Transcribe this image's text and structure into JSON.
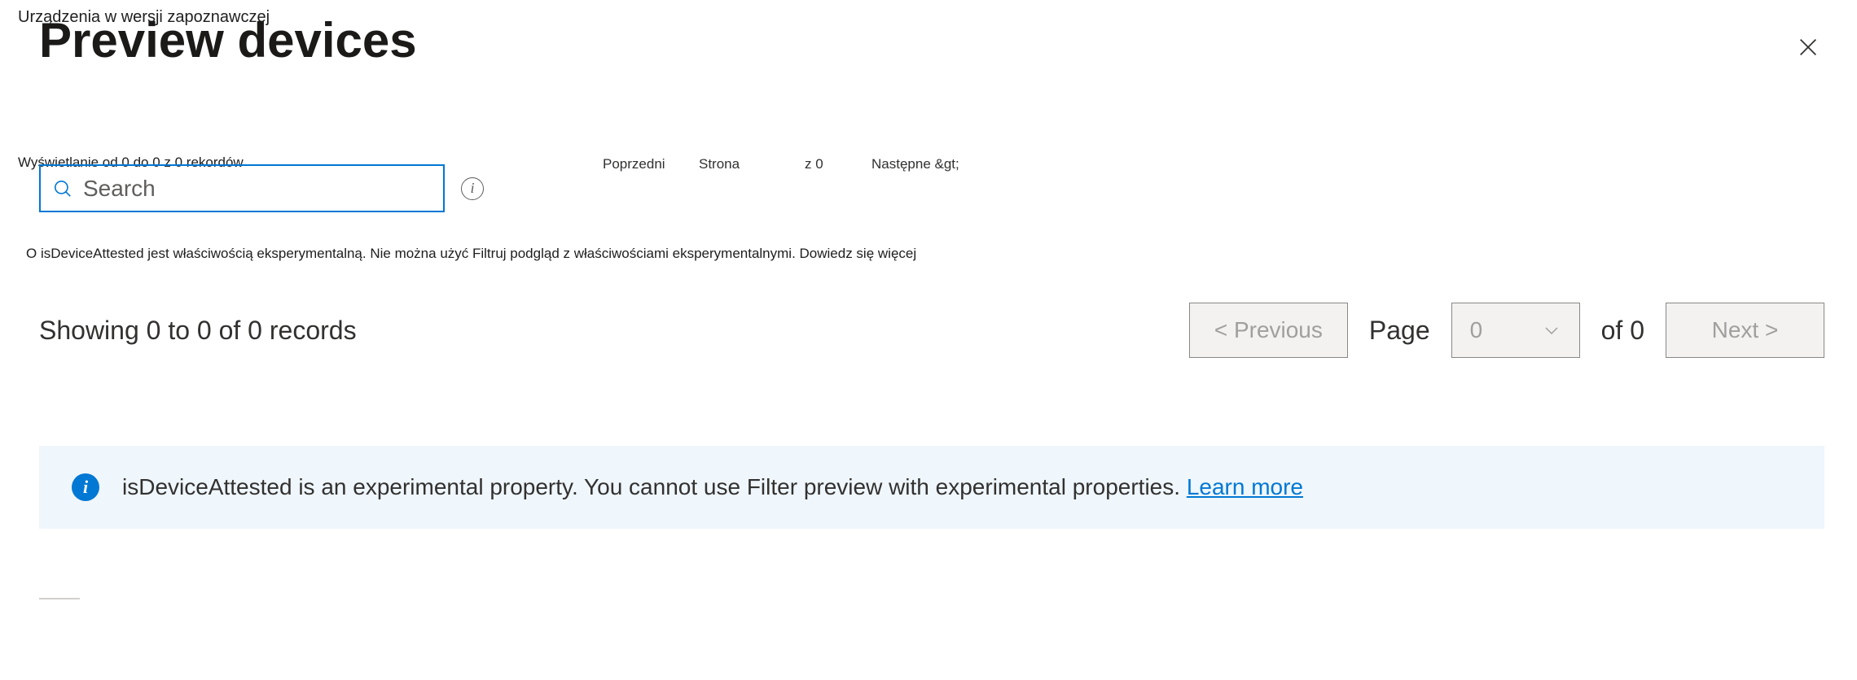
{
  "overlay": {
    "title_pl": "Urządzenia w wersji zapoznawczej",
    "showing_pl": "Wyświetlanie od 0 do 0 z 0 rekordów",
    "prev_pl": "Poprzedni",
    "strona_pl": "Strona",
    "z0_pl": "z 0",
    "next_pl": "Następne &gt;",
    "experimental_pl": "O isDeviceAttested jest właściwością eksperymentalną. Nie można użyć    Filtruj podgląd z właściwościami eksperymentalnymi. Dowiedz się więcej"
  },
  "header": {
    "title": "Preview devices"
  },
  "search": {
    "placeholder": "Search"
  },
  "records": {
    "text": "Showing 0 to 0 of 0 records"
  },
  "pagination": {
    "prev": "<  Previous",
    "page_label": "Page",
    "page_value": "0",
    "of_text": "of 0",
    "next": "Next  >"
  },
  "banner": {
    "text": "isDeviceAttested is an experimental property. You cannot use Filter preview with experimental properties. ",
    "link": "Learn more"
  }
}
